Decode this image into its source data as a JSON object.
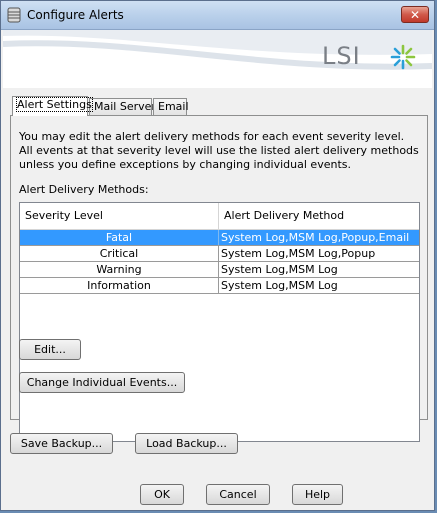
{
  "window": {
    "title": "Configure Alerts",
    "close_label": "✕",
    "brand_logo": "LSI"
  },
  "tabs": [
    {
      "label": "Alert Settings",
      "active": true
    },
    {
      "label": "Mail Server",
      "active": false
    },
    {
      "label": "Email",
      "active": false
    }
  ],
  "alert_settings": {
    "description": "You may edit the alert delivery methods for each event severity level. All events at that severity level will use the listed alert delivery methods unless you define exceptions by changing individual events.",
    "methods_label": "Alert Delivery Methods:",
    "table": {
      "columns": [
        "Severity Level",
        "Alert Delivery Method"
      ],
      "rows": [
        {
          "severity": "Fatal",
          "method": "System Log,MSM Log,Popup,Email",
          "selected": true
        },
        {
          "severity": "Critical",
          "method": "System Log,MSM Log,Popup",
          "selected": false
        },
        {
          "severity": "Warning",
          "method": "System Log,MSM Log",
          "selected": false
        },
        {
          "severity": "Information",
          "method": "System Log,MSM Log",
          "selected": false
        }
      ]
    },
    "edit_label": "Edit...",
    "change_events_label": "Change Individual Events..."
  },
  "backup": {
    "save_label": "Save Backup...",
    "load_label": "Load Backup..."
  },
  "footer": {
    "ok_label": "OK",
    "cancel_label": "Cancel",
    "help_label": "Help"
  },
  "colors": {
    "selection": "#3399ff",
    "logo_green": "#8cc63f",
    "logo_blue": "#2a9fd8",
    "close_red": "#c0392b"
  }
}
